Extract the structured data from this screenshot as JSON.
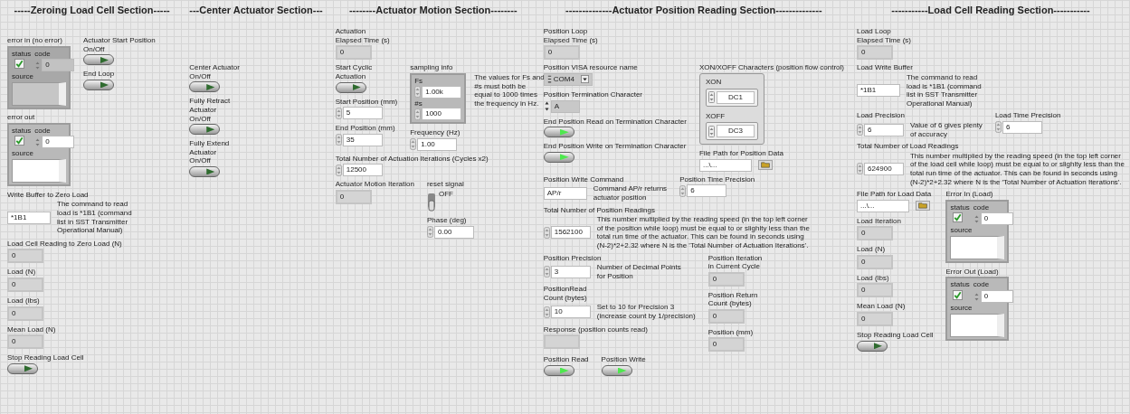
{
  "sections": [
    {
      "heading": "-----Zeroing Load Cell Section-----",
      "rows": [
        {
          "columns": [
            {
              "items": [
                {
                  "kind": "error",
                  "label": "error in (no error)",
                  "status_label": "status",
                  "code_label": "code",
                  "source_label": "source",
                  "checked": true,
                  "disabled": true,
                  "code": "0"
                }
              ]
            },
            {
              "items": [
                {
                  "kind": "button",
                  "label": "Actuator Start Position\nOn/Off",
                  "on": false
                },
                {
                  "kind": "button",
                  "label": "End Loop",
                  "on": false
                }
              ]
            }
          ]
        },
        {
          "columns": [
            {
              "items": [
                {
                  "kind": "error",
                  "label": "error out",
                  "status_label": "status",
                  "code_label": "code",
                  "source_label": "source",
                  "checked": true,
                  "disabled": false,
                  "code": "0"
                },
                {
                  "kind": "string",
                  "label": "Write Buffer to Zero Load",
                  "value": "*1B1",
                  "note": "The command to read\nload is *1B1 (command\nlist in SST Transmitter\nOperational Manual)"
                },
                {
                  "kind": "indicator",
                  "label": "Load Cell Reading to Zero Load (N)",
                  "value": "0"
                },
                {
                  "kind": "indicator",
                  "label": "Load (N)",
                  "value": "0"
                },
                {
                  "kind": "indicator",
                  "label": "Load (lbs)",
                  "value": "0"
                },
                {
                  "kind": "indicator",
                  "label": "Mean Load (N)",
                  "value": "0"
                },
                {
                  "kind": "button",
                  "label": "Stop Reading Load Cell",
                  "on": false
                }
              ]
            }
          ]
        }
      ]
    },
    {
      "heading": "---Center Actuator Section---",
      "rows": [
        {
          "columns": [
            {
              "items": [
                {
                  "kind": "button",
                  "label": "Center Actuator\nOn/Off",
                  "on": false
                },
                {
                  "kind": "button",
                  "label": "Fully Retract\nActuator\nOn/Off",
                  "on": false
                },
                {
                  "kind": "button",
                  "label": "Fully Extend\nActuator\nOn/Off",
                  "on": false
                }
              ]
            }
          ]
        }
      ]
    },
    {
      "heading": "--------Actuator Motion Section--------",
      "rows": [
        {
          "columns": [
            {
              "items": [
                {
                  "kind": "indicator",
                  "label": "Actuation\nElapsed Time (s)",
                  "value": "0"
                }
              ]
            }
          ]
        },
        {
          "columns": [
            {
              "items": [
                {
                  "kind": "button",
                  "label": "Start Cyclic\nActuation",
                  "on": false
                },
                {
                  "kind": "numeric",
                  "label": "Start Position (mm)",
                  "value": "5"
                },
                {
                  "kind": "numeric",
                  "label": "End Position (mm)",
                  "value": "35"
                }
              ]
            },
            {
              "items": [
                {
                  "kind": "sampling",
                  "label": "sampling info",
                  "fields": [
                    {
                      "label": "Fs",
                      "value": "1.00k"
                    },
                    {
                      "label": "#s",
                      "value": "1000"
                    }
                  ],
                  "note": "The values for Fs and\n#s must both be\nequal to 1000 times\nthe frequency in Hz."
                },
                {
                  "kind": "numeric",
                  "label": "Frequency (Hz)",
                  "value": "1.00"
                }
              ]
            }
          ]
        },
        {
          "columns": [
            {
              "items": [
                {
                  "kind": "numeric",
                  "label": "Total Number of Actuation Iterations (Cycles x2)",
                  "value": "12500"
                }
              ]
            }
          ]
        },
        {
          "columns": [
            {
              "items": [
                {
                  "kind": "indicator",
                  "label": "Actuator Motion Iteration",
                  "value": "0"
                }
              ]
            },
            {
              "items": [
                {
                  "kind": "switch",
                  "label": "reset signal",
                  "text": "OFF",
                  "on": false
                },
                {
                  "kind": "numeric",
                  "label": "Phase (deg)",
                  "value": "0.00"
                }
              ]
            }
          ]
        }
      ]
    },
    {
      "heading": "--------------Actuator Position Reading Section--------------",
      "rows": [
        {
          "columns": [
            {
              "items": [
                {
                  "kind": "indicator",
                  "label": "Position Loop\nElapsed Time (s)",
                  "value": "0"
                }
              ]
            }
          ]
        },
        {
          "columns": [
            {
              "items": [
                {
                  "kind": "visa",
                  "label": "Position VISA resource name",
                  "value": "COM4"
                },
                {
                  "kind": "char",
                  "label": "Position Termination Character",
                  "value": "A"
                },
                {
                  "kind": "button",
                  "label": "End Position Read on Termination Character",
                  "on": true
                },
                {
                  "kind": "button",
                  "label": "End Position Write on Termination Character",
                  "on": true
                }
              ]
            },
            {
              "items": [
                {
                  "kind": "xon",
                  "label": "XON/XOFF Characters (position flow control)",
                  "fields": [
                    {
                      "label": "XON",
                      "value": "DC1"
                    },
                    {
                      "label": "XOFF",
                      "value": "DC3"
                    }
                  ]
                },
                {
                  "kind": "path",
                  "label": "File Path for Position Data",
                  "value": "...\\..."
                }
              ]
            }
          ]
        },
        {
          "columns": [
            {
              "items": [
                {
                  "kind": "string",
                  "label": "Position Write Command",
                  "value": "AP/r",
                  "note": "Command AP/r returns\nactuator position"
                }
              ]
            },
            {
              "items": [
                {
                  "kind": "numeric",
                  "label": "Position Time Precision",
                  "value": "6"
                }
              ]
            }
          ]
        },
        {
          "columns": [
            {
              "items": [
                {
                  "kind": "numeric",
                  "label": "Total Number of Position Readings",
                  "value": "1562100",
                  "note": "This number multiplied by the reading speed (in the top left corner\nof the position while loop) must be equal to or slighlty less than the\ntotal run time of the actuator. This can be found in seconds using\n(N-2)*2+2.32 where N is the 'Total Number of Actuation Iterations'."
                }
              ]
            }
          ]
        },
        {
          "columns": [
            {
              "items": [
                {
                  "kind": "numeric",
                  "label": "Position Precision",
                  "value": "3",
                  "note": "Number of Decimal Points\nfor Position"
                },
                {
                  "kind": "numeric",
                  "label": "PositionRead\nCount (bytes)",
                  "value": "10",
                  "note": "Set to 10 for Precision 3\n(increase count by 1/precision)"
                },
                {
                  "kind": "indicator",
                  "label": "Response (position counts read)"
                }
              ]
            },
            {
              "items": [
                {
                  "kind": "indicator",
                  "label": "Position Iteration\nin Current Cycle",
                  "value": "0"
                },
                {
                  "kind": "indicator",
                  "label": "Position Return\nCount (bytes)",
                  "value": "0"
                },
                {
                  "kind": "indicator",
                  "label": "Position (mm)",
                  "value": "0"
                }
              ]
            }
          ]
        },
        {
          "columns": [
            {
              "items": [
                {
                  "kind": "button",
                  "label": "Position Read",
                  "on": true
                }
              ]
            },
            {
              "items": [
                {
                  "kind": "button",
                  "label": "Position Write",
                  "on": true
                }
              ]
            }
          ]
        }
      ]
    },
    {
      "heading": "-----------Load Cell Reading Section-----------",
      "rows": [
        {
          "columns": [
            {
              "items": [
                {
                  "kind": "indicator",
                  "label": "Load Loop\nElapsed Time (s)",
                  "value": "0"
                }
              ]
            }
          ]
        },
        {
          "columns": [
            {
              "items": [
                {
                  "kind": "string",
                  "label": "Load Write Buffer",
                  "value": "*1B1",
                  "note": "The command to read\nload is *1B1 (command\nlist in SST Transmitter\nOperational Manual)"
                }
              ]
            }
          ]
        },
        {
          "columns": [
            {
              "items": [
                {
                  "kind": "numeric",
                  "label": "Load Precision",
                  "value": "6",
                  "note": "Value of 6 gives plenty\nof accuracy"
                }
              ]
            },
            {
              "items": [
                {
                  "kind": "numeric",
                  "label": "Load Time Precision",
                  "value": "6"
                }
              ]
            }
          ]
        },
        {
          "columns": [
            {
              "items": [
                {
                  "kind": "numeric",
                  "label": "Total Number of Load Readings",
                  "value": "624900",
                  "note": "This number multiplied by the reading speed (in the top left corner\nof the load cell while loop) must be equal to or slighlty less than the\ntotal run time of the actuator. This can be found in seconds using\n(N-2)*2+2.32 where N is the 'Total Number of Actuation Iterations'."
                }
              ]
            }
          ]
        },
        {
          "columns": [
            {
              "items": [
                {
                  "kind": "path",
                  "label": "File Path for Load Data",
                  "value": "...\\..."
                },
                {
                  "kind": "indicator",
                  "label": "Load Iteration",
                  "value": "0"
                },
                {
                  "kind": "indicator",
                  "label": "Load (N)",
                  "value": "0"
                },
                {
                  "kind": "indicator",
                  "label": "Load (lbs)",
                  "value": "0"
                },
                {
                  "kind": "indicator",
                  "label": "Mean Load (N)",
                  "value": "0"
                },
                {
                  "kind": "button",
                  "label": "Stop Reading Load Cell",
                  "on": false
                }
              ]
            },
            {
              "items": [
                {
                  "kind": "error",
                  "label": "Error In (Load)",
                  "status_label": "status",
                  "code_label": "code",
                  "source_label": "source",
                  "checked": true,
                  "disabled": false,
                  "code": "0"
                },
                {
                  "kind": "error",
                  "label": "Error Out (Load)",
                  "status_label": "status",
                  "code_label": "code",
                  "source_label": "source",
                  "checked": true,
                  "disabled": false,
                  "code": "0"
                }
              ]
            }
          ]
        }
      ]
    }
  ]
}
